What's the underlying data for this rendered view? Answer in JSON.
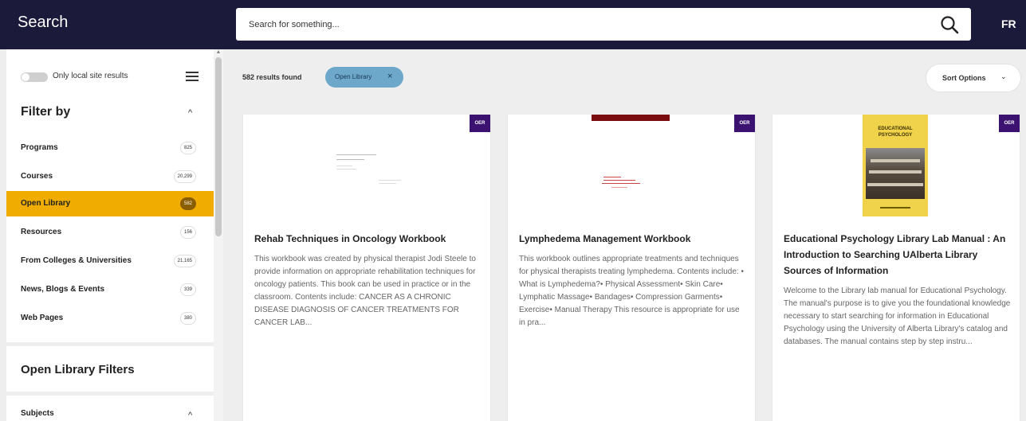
{
  "header": {
    "title": "Search",
    "search_placeholder": "Search for something...",
    "language": "FR"
  },
  "sidebar": {
    "toggle_label": "Only local site results",
    "filter_title": "Filter by",
    "items": [
      {
        "label": "Programs",
        "count": "825"
      },
      {
        "label": "Courses",
        "count": "20,299"
      },
      {
        "label": "Open Library",
        "count": "582"
      },
      {
        "label": "Resources",
        "count": "156"
      },
      {
        "label": "From Colleges & Universities",
        "count": "21,165"
      },
      {
        "label": "News, Blogs & Events",
        "count": "339"
      },
      {
        "label": "Web Pages",
        "count": "380"
      }
    ],
    "open_library_filters": "Open Library Filters",
    "subjects": "Subjects"
  },
  "results": {
    "count_text": "582 results found",
    "chip_label": "Open Library",
    "chip_close": "×",
    "sort_label": "Sort Options"
  },
  "cards": [
    {
      "badge": "OER",
      "title": "Rehab Techniques in Oncology Workbook",
      "description": "This workbook was created by physical therapist Jodi Steele to provide information on appropriate rehabilitation techniques for oncology patients. This book can be used in practice or in the classroom. Contents include: CANCER AS A CHRONIC DISEASE DIAGNOSIS OF CANCER TREATMENTS FOR CANCER LAB..."
    },
    {
      "badge": "OER",
      "title": "Lymphedema Management Workbook",
      "description": "This workbook outlines appropriate treatments and techniques for physical therapists treating lymphedema. Contents include: • What is Lymphedema?• Physical Assessment• Skin Care• Lymphatic Massage• Bandages• Compression Garments• Exercise• Manual Therapy This resource is appropriate for use in pra..."
    },
    {
      "badge": "OER",
      "title": "Educational Psychology Library Lab Manual : An Introduction to Searching UAlberta Library Sources of Information",
      "description": "Welcome to the Library lab manual for Educational Psychology. The manual's purpose is to give you the foundational knowledge necessary to start searching for information in Educational Psychology using the University of Alberta Library's catalog and databases. The manual contains step by step instru...",
      "cover_text": "EDUCATIONAL PSYCHOLOGY"
    }
  ],
  "colors": {
    "header_bg": "#1b1a3a",
    "active_filter": "#f0ad00",
    "chip_bg": "#6da7c9",
    "badge_bg": "#3b1270"
  }
}
